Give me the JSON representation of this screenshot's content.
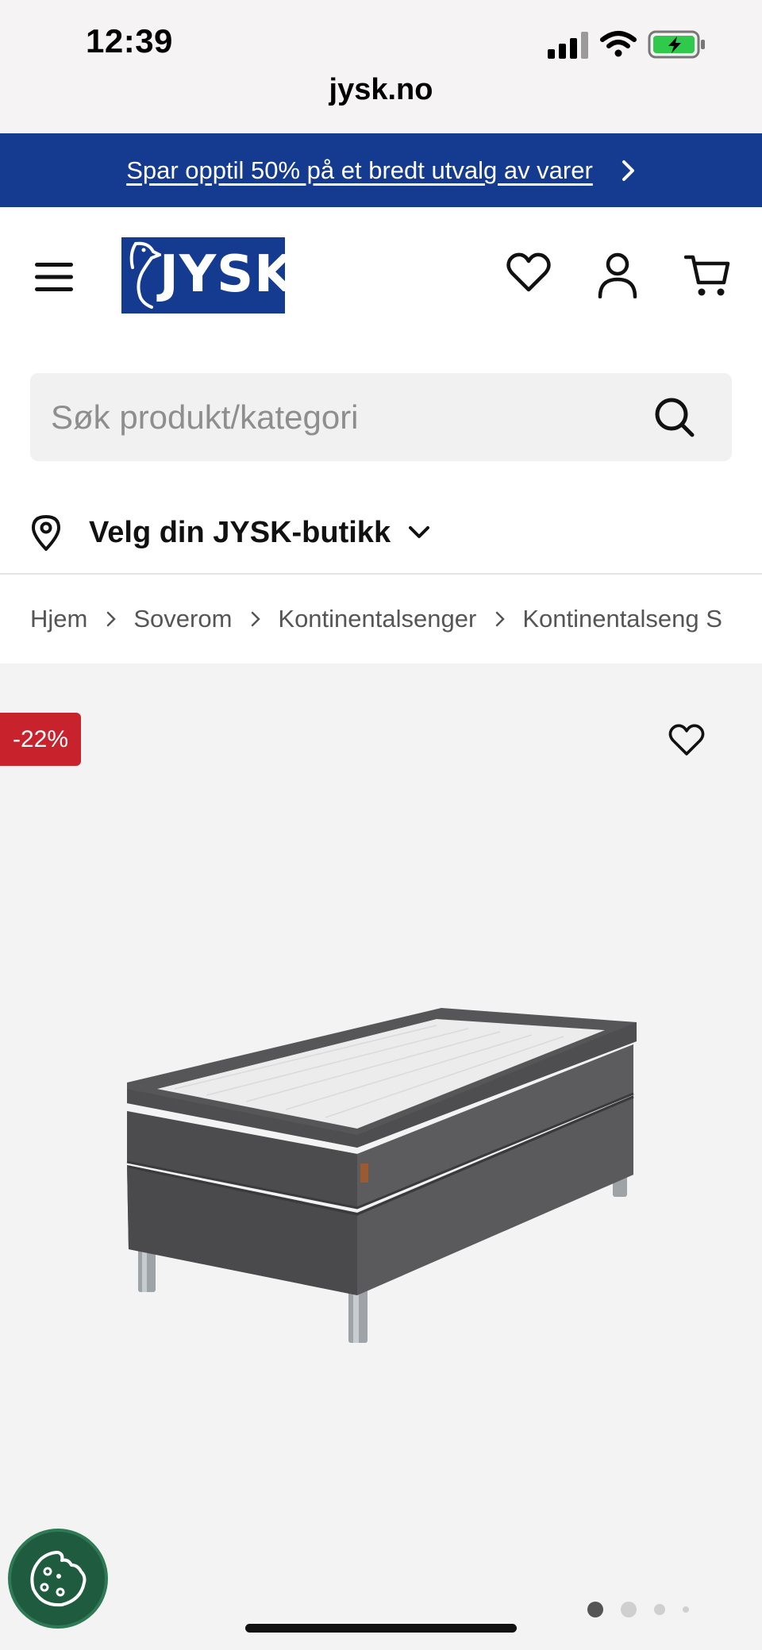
{
  "status_bar": {
    "time": "12:39"
  },
  "browser": {
    "url": "jysk.no"
  },
  "promo": {
    "text": "Spar opptil 50% på et bredt utvalg av varer"
  },
  "header": {
    "logo_text": "JYSK"
  },
  "search": {
    "placeholder": "Søk produkt/kategori"
  },
  "store_selector": {
    "label": "Velg din JYSK-butikk"
  },
  "breadcrumb": [
    "Hjem",
    "Soverom",
    "Kontinentalsenger",
    "Kontinentalseng S"
  ],
  "product": {
    "discount_badge": "-22%",
    "image_dots": {
      "count": 4,
      "active": 0
    }
  },
  "colors": {
    "brand_blue": "#143b8f",
    "badge_red": "#c8232c",
    "cookie_green": "#1f5c3f",
    "gallery_bg": "#f3f3f3"
  },
  "icons": [
    "signal-icon",
    "wifi-icon",
    "battery-icon",
    "chevron-right-icon",
    "menu-icon",
    "heart-icon",
    "user-icon",
    "cart-icon",
    "search-icon",
    "location-pin-icon",
    "chevron-down-icon",
    "cookie-icon"
  ]
}
